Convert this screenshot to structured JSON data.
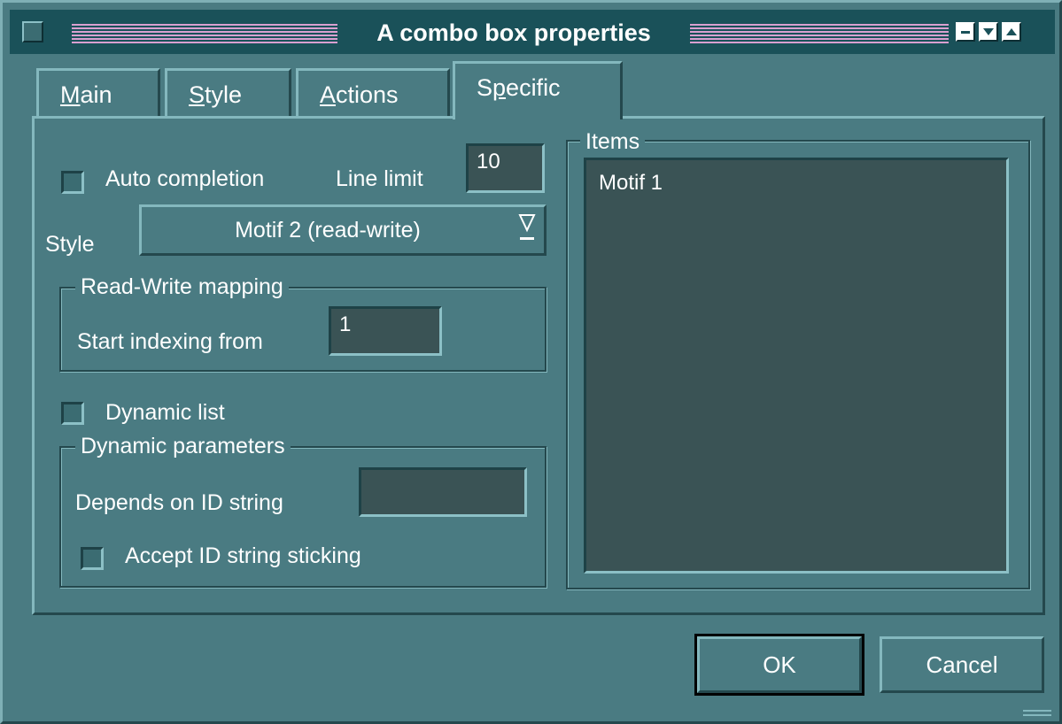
{
  "window": {
    "title": "A combo box properties"
  },
  "tabs": [
    {
      "label": "Main",
      "mnemonic": "M",
      "rest": "ain"
    },
    {
      "label": "Style",
      "mnemonic": "S",
      "rest": "tyle"
    },
    {
      "label": "Actions",
      "mnemonic": "A",
      "rest": "ctions"
    },
    {
      "label": "Specific",
      "pre": "S",
      "mnemonic": "p",
      "rest": "ecific"
    }
  ],
  "active_tab": "Specific",
  "specific": {
    "auto_completion_label": "Auto completion",
    "auto_completion_checked": false,
    "line_limit_label": "Line limit",
    "line_limit_value": "10",
    "style_label": "Style",
    "style_value": "Motif 2 (read-write)",
    "rw_group_title": "Read-Write mapping",
    "start_indexing_label": "Start indexing from",
    "start_indexing_value": "1",
    "dynamic_list_label": "Dynamic list",
    "dynamic_list_checked": false,
    "dyn_group_title": "Dynamic parameters",
    "depends_label": "Depends on ID string",
    "depends_value": "",
    "accept_sticking_label": "Accept ID string sticking",
    "accept_sticking_checked": false,
    "items_group_title": "Items",
    "items": [
      "Motif 1"
    ]
  },
  "buttons": {
    "ok": "OK",
    "cancel": "Cancel"
  },
  "colors": {
    "dialog_bg": "#4a7b82",
    "titlebar_bg": "#1a5159",
    "title_stripe": "#d9a0d0",
    "field_bg": "#3a5355"
  }
}
